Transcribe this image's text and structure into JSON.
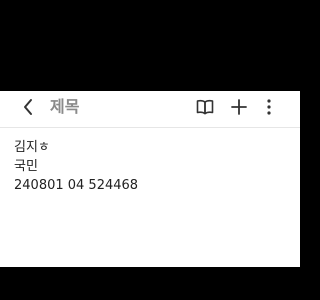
{
  "app": {
    "title": "제목",
    "background_color": "#ffffff",
    "title_color": "#8a8a8a"
  },
  "toolbar": {
    "back_icon": "chevron-left-icon",
    "reader_icon": "book-open-icon",
    "add_icon": "plus-icon",
    "more_icon": "more-vertical-icon"
  },
  "note": {
    "lines": [
      "김지ㅎ",
      "국민",
      "240801 04 524468"
    ]
  }
}
